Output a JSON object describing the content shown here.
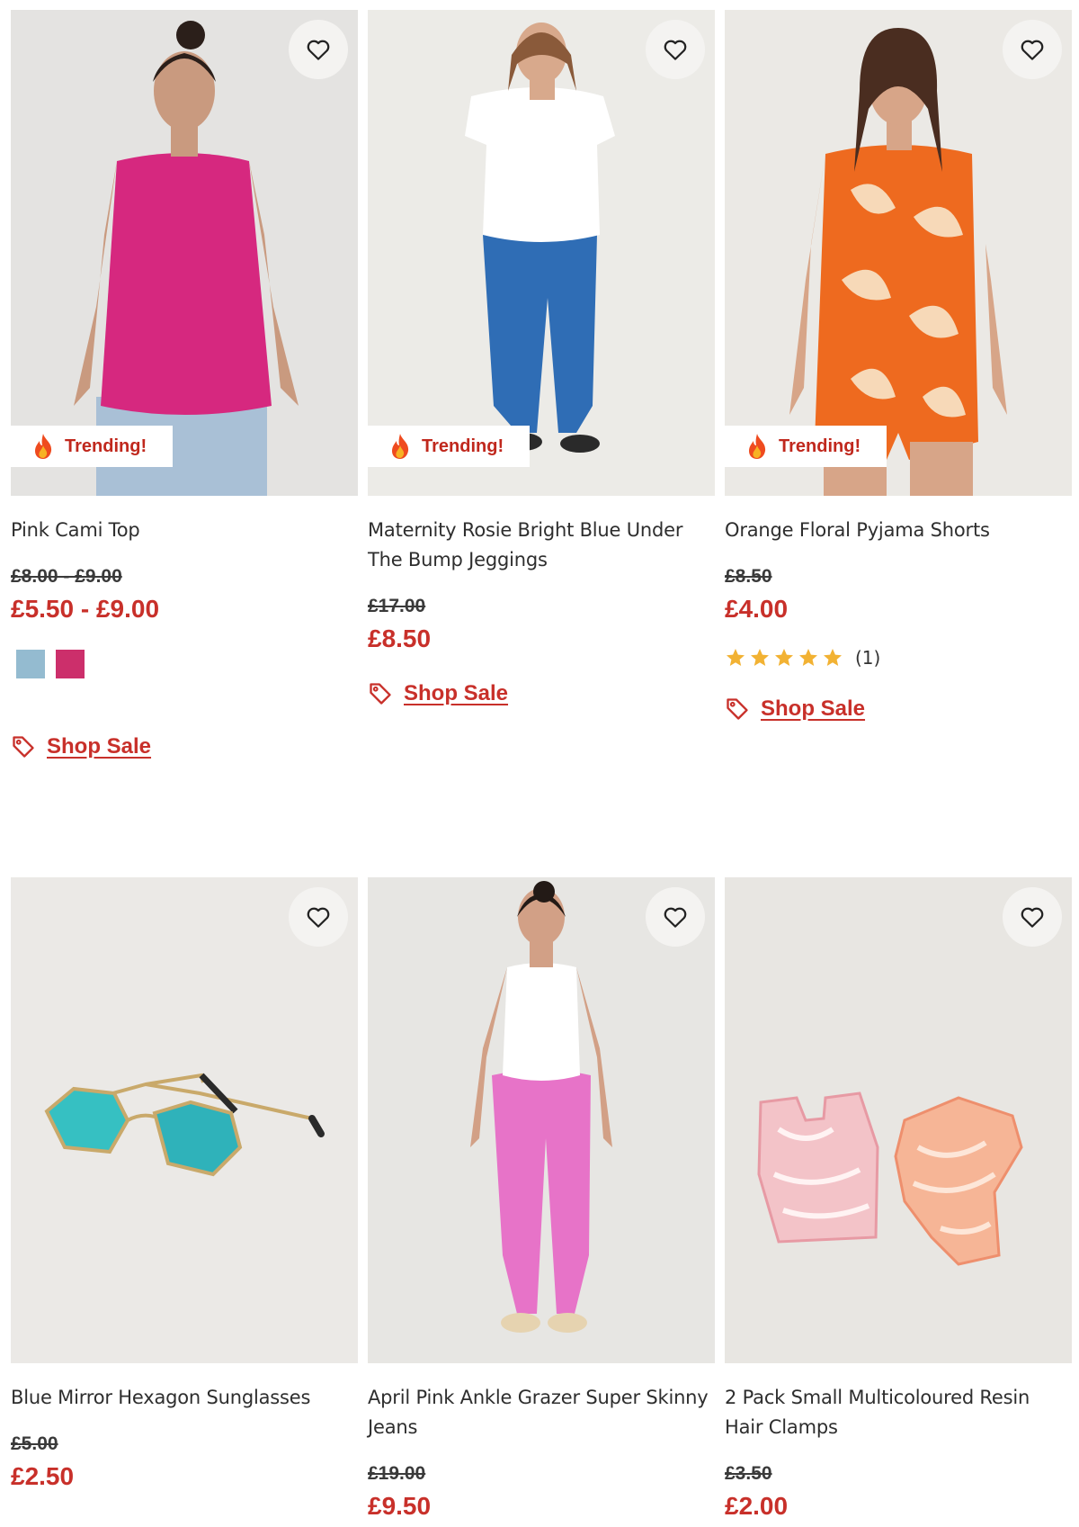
{
  "colors": {
    "sale_red": "#c8302a",
    "trend_red": "#c0281d",
    "star_gold": "#f2b233"
  },
  "badges": {
    "trending": "Trending!"
  },
  "actions": {
    "shop_sale": "Shop Sale",
    "wishlist_icon": "heart-outline-icon"
  },
  "products": [
    {
      "name": "Pink Cami Top",
      "was": "£8.00 - £9.00",
      "now": "£5.50 - £9.00",
      "trending": true,
      "swatches": [
        "#94bbd0",
        "#cc2f6b"
      ]
    },
    {
      "name": "Maternity Rosie Bright Blue Under The Bump Jeggings",
      "was": "£17.00",
      "now": "£8.50",
      "trending": true
    },
    {
      "name": "Orange Floral Pyjama Shorts",
      "was": "£8.50",
      "now": "£4.00",
      "trending": true,
      "rating": {
        "stars": 5,
        "count_label": "(1)"
      }
    },
    {
      "name": "Blue Mirror Hexagon Sunglasses",
      "was": "£5.00",
      "now": "£2.50",
      "trending": false
    },
    {
      "name": "April Pink Ankle Grazer Super Skinny Jeans",
      "was": "£19.00",
      "now": "£9.50",
      "trending": false
    },
    {
      "name": "2 Pack Small Multicoloured Resin Hair Clamps",
      "was": "£3.50",
      "now": "£2.00",
      "trending": false
    }
  ]
}
